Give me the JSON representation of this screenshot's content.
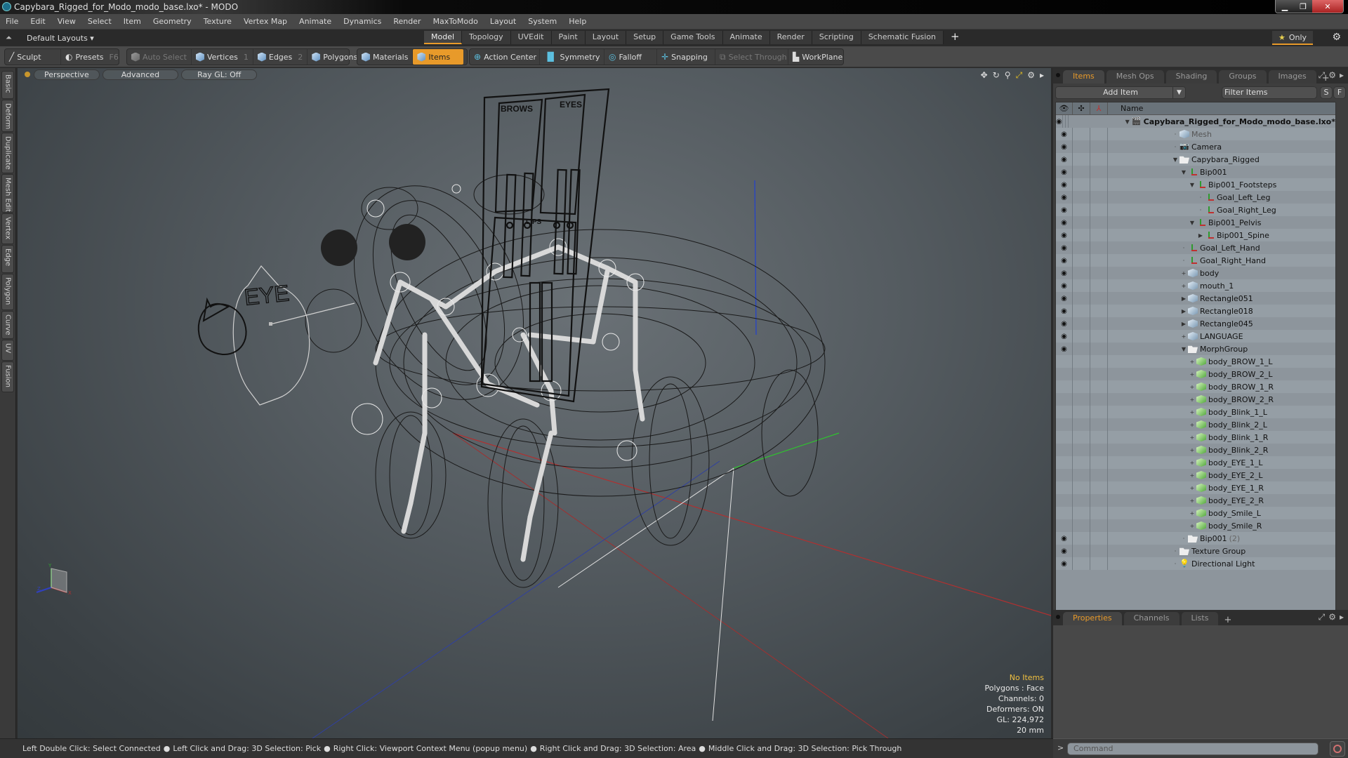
{
  "window": {
    "title": "Capybara_Rigged_for_Modo_modo_base.lxo* - MODO",
    "minimize": "▁",
    "maximize": "❐",
    "close": "✕"
  },
  "menu": [
    "File",
    "Edit",
    "View",
    "Select",
    "Item",
    "Geometry",
    "Texture",
    "Vertex Map",
    "Animate",
    "Dynamics",
    "Render",
    "MaxToModo",
    "Layout",
    "System",
    "Help"
  ],
  "layoutbar": {
    "default_layouts": "Default Layouts ▾",
    "tabs": [
      "Model",
      "Topology",
      "UVEdit",
      "Paint",
      "Layout",
      "Setup",
      "Game Tools",
      "Animate",
      "Render",
      "Scripting",
      "Schematic Fusion"
    ],
    "active_tab": "Model",
    "add_tab": "+",
    "only_label": "Only"
  },
  "toolbar": {
    "sculpt": "Sculpt",
    "presets": "Presets",
    "presets_key": "F6",
    "auto_select": "Auto Select",
    "vertices": "Vertices",
    "vertices_key": "1",
    "edges": "Edges",
    "edges_key": "2",
    "polygons": "Polygons",
    "materials": "Materials",
    "items": "Items",
    "action_center": "Action Center",
    "symmetry": "Symmetry",
    "falloff": "Falloff",
    "snapping": "Snapping",
    "select_through": "Select Through",
    "workplane": "WorkPlane"
  },
  "left_tabs": [
    "Basic",
    "Deform",
    "Duplicate",
    "Mesh Edit",
    "Vertex",
    "Edge",
    "Polygon",
    "Curve",
    "UV",
    "Fusion"
  ],
  "viewport": {
    "view_mode": "Perspective",
    "shading": "Advanced",
    "raygl": "Ray GL: Off",
    "labels": {
      "brows": "BROWS",
      "eyes": "EYES",
      "lips": "LIPS",
      "eye_control": "EYE"
    },
    "stats": {
      "selection": "No Items",
      "polygons": "Polygons : Face",
      "channels": "Channels: 0",
      "deformers": "Deformers: ON",
      "gl": "GL: 224,972",
      "scale": "20 mm"
    },
    "axis": {
      "x": "X",
      "y": "Y",
      "z": "Z"
    }
  },
  "statusbar": {
    "hints": [
      "Left Double Click: Select Connected",
      "Left Click and Drag: 3D Selection: Pick",
      "Right Click: Viewport Context Menu (popup menu)",
      "Right Click and Drag: 3D Selection: Area",
      "Middle Click and Drag: 3D Selection: Pick Through"
    ]
  },
  "items_panel": {
    "tabs": [
      "Items",
      "Mesh Ops",
      "Shading",
      "Groups",
      "Images"
    ],
    "active_tab": "Items",
    "add_item": "Add Item",
    "filter_placeholder": "Filter Items",
    "s_button": "S",
    "f_button": "F",
    "column_name": "Name",
    "tree": [
      {
        "name": "Capybara_Rigged_for_Modo_modo_base.lxo*",
        "depth": 0,
        "icon": "scene",
        "exp": "▼",
        "bold": true,
        "eye": true
      },
      {
        "name": "Mesh",
        "depth": 1,
        "icon": "mesh",
        "exp": "",
        "gray": true,
        "eye": true
      },
      {
        "name": "Camera",
        "depth": 1,
        "icon": "cam",
        "exp": "",
        "eye": true
      },
      {
        "name": "Capybara_Rigged",
        "depth": 1,
        "icon": "folder",
        "exp": "▼",
        "eye": true
      },
      {
        "name": "Bip001",
        "depth": 2,
        "icon": "loc",
        "exp": "▼",
        "eye": true
      },
      {
        "name": "Bip001_Footsteps",
        "depth": 3,
        "icon": "loc",
        "exp": "▼",
        "eye": true
      },
      {
        "name": "Goal_Left_Leg",
        "depth": 4,
        "icon": "loc",
        "exp": "",
        "eye": true
      },
      {
        "name": "Goal_Right_Leg",
        "depth": 4,
        "icon": "loc",
        "exp": "",
        "eye": true
      },
      {
        "name": "Bip001_Pelvis",
        "depth": 3,
        "icon": "loc",
        "exp": "▼",
        "eye": true
      },
      {
        "name": "Bip001_Spine",
        "depth": 4,
        "icon": "loc",
        "exp": "▶",
        "eye": true
      },
      {
        "name": "Goal_Left_Hand",
        "depth": 2,
        "icon": "loc",
        "exp": "",
        "eye": true
      },
      {
        "name": "Goal_Right_Hand",
        "depth": 2,
        "icon": "loc",
        "exp": "",
        "eye": true
      },
      {
        "name": "body",
        "depth": 2,
        "icon": "mesh",
        "exp": "+",
        "eye": true
      },
      {
        "name": "mouth_1",
        "depth": 2,
        "icon": "mesh",
        "exp": "+",
        "eye": true
      },
      {
        "name": "Rectangle051",
        "depth": 2,
        "icon": "mesh",
        "exp": "▶",
        "eye": true
      },
      {
        "name": "Rectangle018",
        "depth": 2,
        "icon": "mesh",
        "exp": "▶",
        "eye": true
      },
      {
        "name": "Rectangle045",
        "depth": 2,
        "icon": "mesh",
        "exp": "▶",
        "eye": true
      },
      {
        "name": "LANGUAGE",
        "depth": 2,
        "icon": "mesh",
        "exp": "+",
        "eye": true
      },
      {
        "name": "MorphGroup",
        "depth": 2,
        "icon": "folder",
        "exp": "▼",
        "eye": true
      },
      {
        "name": "body_BROW_1_L",
        "depth": 3,
        "icon": "morph",
        "exp": "+",
        "eye": false
      },
      {
        "name": "body_BROW_2_L",
        "depth": 3,
        "icon": "morph",
        "exp": "+",
        "eye": false
      },
      {
        "name": "body_BROW_1_R",
        "depth": 3,
        "icon": "morph",
        "exp": "+",
        "eye": false
      },
      {
        "name": "body_BROW_2_R",
        "depth": 3,
        "icon": "morph",
        "exp": "+",
        "eye": false
      },
      {
        "name": "body_Blink_1_L",
        "depth": 3,
        "icon": "morph",
        "exp": "+",
        "eye": false
      },
      {
        "name": "body_Blink_2_L",
        "depth": 3,
        "icon": "morph",
        "exp": "+",
        "eye": false
      },
      {
        "name": "body_Blink_1_R",
        "depth": 3,
        "icon": "morph",
        "exp": "+",
        "eye": false
      },
      {
        "name": "body_Blink_2_R",
        "depth": 3,
        "icon": "morph",
        "exp": "+",
        "eye": false
      },
      {
        "name": "body_EYE_1_L",
        "depth": 3,
        "icon": "morph",
        "exp": "+",
        "eye": false
      },
      {
        "name": "body_EYE_2_L",
        "depth": 3,
        "icon": "morph",
        "exp": "+",
        "eye": false
      },
      {
        "name": "body_EYE_1_R",
        "depth": 3,
        "icon": "morph",
        "exp": "+",
        "eye": false
      },
      {
        "name": "body_EYE_2_R",
        "depth": 3,
        "icon": "morph",
        "exp": "+",
        "eye": false
      },
      {
        "name": "body_Smile_L",
        "depth": 3,
        "icon": "morph",
        "exp": "+",
        "eye": false
      },
      {
        "name": "body_Smile_R",
        "depth": 3,
        "icon": "morph",
        "exp": "+",
        "eye": false
      },
      {
        "name": "Bip001",
        "depth": 2,
        "icon": "folder",
        "exp": "",
        "count": "(2)",
        "eye": true
      },
      {
        "name": "Texture Group",
        "depth": 1,
        "icon": "folder",
        "exp": "",
        "eye": true
      },
      {
        "name": "Directional Light",
        "depth": 1,
        "icon": "light",
        "exp": "",
        "eye": true
      }
    ]
  },
  "properties_panel": {
    "tabs": [
      "Properties",
      "Channels",
      "Lists"
    ],
    "active_tab": "Properties"
  },
  "command": {
    "placeholder": "Command",
    "prompt": ">"
  },
  "colors": {
    "accent": "#e89a2a",
    "tree_bg": "#8d959c",
    "status_warn": "#f0c040"
  }
}
